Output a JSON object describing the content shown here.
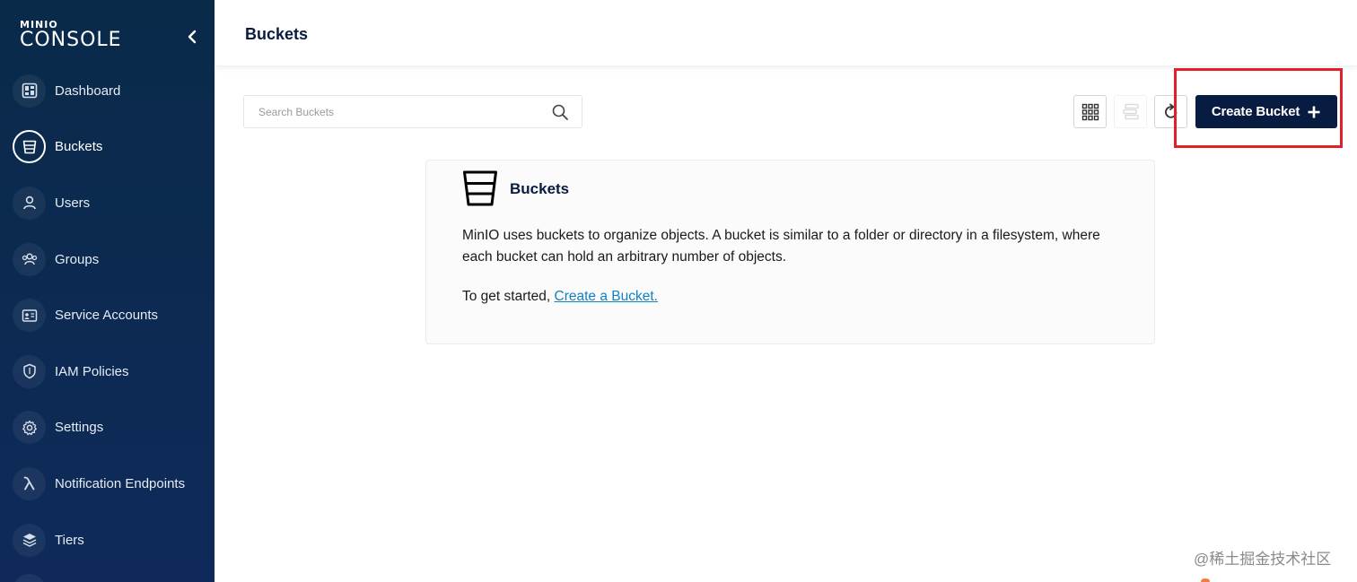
{
  "brand": {
    "small": "MINIO",
    "big": "CONSOLE"
  },
  "sidebar": {
    "items": [
      {
        "label": "Dashboard",
        "icon": "dashboard-icon",
        "active": false
      },
      {
        "label": "Buckets",
        "icon": "bucket-icon",
        "active": true
      },
      {
        "label": "Users",
        "icon": "user-icon",
        "active": false
      },
      {
        "label": "Groups",
        "icon": "groups-icon",
        "active": false
      },
      {
        "label": "Service Accounts",
        "icon": "id-card-icon",
        "active": false
      },
      {
        "label": "IAM Policies",
        "icon": "shield-icon",
        "active": false
      },
      {
        "label": "Settings",
        "icon": "gear-icon",
        "active": false
      },
      {
        "label": "Notification Endpoints",
        "icon": "lambda-icon",
        "active": false
      },
      {
        "label": "Tiers",
        "icon": "layers-icon",
        "active": false
      }
    ]
  },
  "header": {
    "title": "Buckets"
  },
  "toolbar": {
    "search_placeholder": "Search Buckets",
    "create_label": "Create Bucket"
  },
  "empty_state": {
    "title": "Buckets",
    "description": "MinIO uses buckets to organize objects. A bucket is similar to a folder or directory in a filesystem, where each bucket can hold an arbitrary number of objects.",
    "start_prefix": "To get started, ",
    "start_link": "Create a Bucket."
  },
  "watermark": "@稀土掘金技术社区",
  "colors": {
    "sidebar": "#0c2a52",
    "primary": "#081c42",
    "link": "#1180c4",
    "highlight": "#e0202b"
  }
}
